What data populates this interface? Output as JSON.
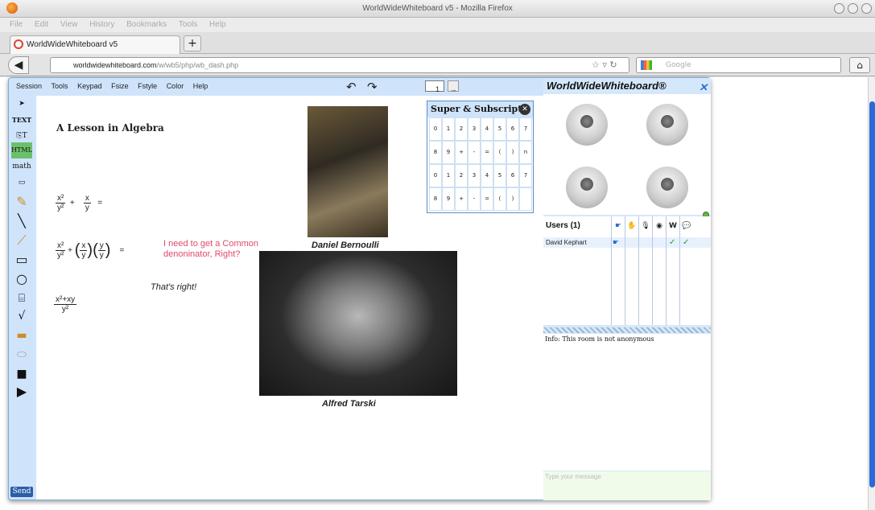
{
  "window": {
    "title": "WorldWideWhiteboard v5 - Mozilla Firefox",
    "menu": [
      "File",
      "Edit",
      "View",
      "History",
      "Bookmarks",
      "Tools",
      "Help"
    ]
  },
  "tab": {
    "label": "WorldWideWhiteboard v5",
    "new_tab": "+"
  },
  "nav": {
    "url_domain": "worldwidewhiteboard.com",
    "url_path": "/w/wb5/php/wb_dash.php",
    "search_placeholder": "Google"
  },
  "app": {
    "menu": [
      "Session",
      "Tools",
      "Keypad",
      "Fsize",
      "Fstyle",
      "Color",
      "Help"
    ],
    "page_number": "1",
    "tools": [
      "TEXT",
      "HTML",
      "math"
    ],
    "send_label": "Send"
  },
  "board": {
    "title": "A Lesson in Algebra",
    "note_red": "I need to get a Common denoninator, Right?",
    "note_reply": "That's right!",
    "caption1": "Daniel Bernoulli",
    "caption2": "Alfred Tarski",
    "eq1": {
      "a_num": "x²",
      "a_den": "y²",
      "plus": "+",
      "b_num": "x",
      "b_den": "y",
      "eq": "="
    },
    "eq2": {
      "a_num": "x²",
      "a_den": "y²",
      "plus": "+",
      "b_num": "x",
      "b_den": "y",
      "c_num": "y",
      "c_den": "y",
      "eq": "="
    },
    "eq3": {
      "num": "x²+xy",
      "den": "y²"
    }
  },
  "superscript": {
    "title": "Super & Subscript",
    "row1": [
      "0",
      "1",
      "2",
      "3",
      "4",
      "5",
      "6",
      "7"
    ],
    "row2": [
      "8",
      "9",
      "+",
      "-",
      "=",
      "(",
      ")",
      "n"
    ],
    "row3": [
      "0",
      "1",
      "2",
      "3",
      "4",
      "5",
      "6",
      "7"
    ],
    "row4": [
      "8",
      "9",
      "+",
      "-",
      "=",
      "(",
      ")",
      ""
    ]
  },
  "panel": {
    "brand": "WorldWideWhiteboard®",
    "close": "✕",
    "users_header": "Users (1)",
    "user_name": "David Kephart",
    "w_label": "W",
    "info": "Info: This room is not anonymous",
    "message_placeholder": "Type your message"
  }
}
